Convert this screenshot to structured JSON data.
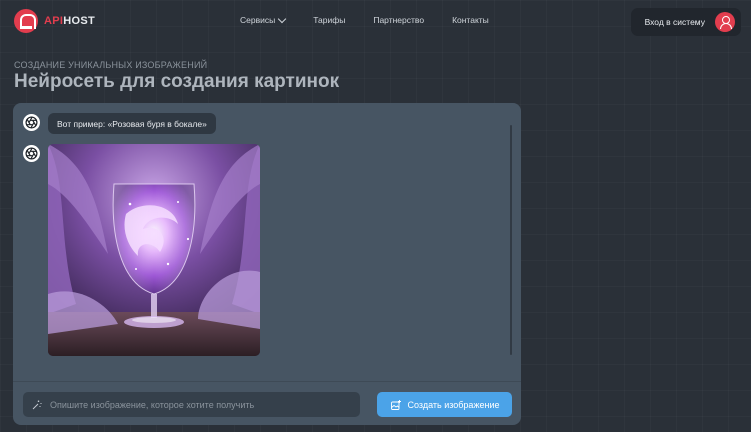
{
  "brand": {
    "api": "API",
    "host": "HOST",
    "accent": "#e23d4e"
  },
  "nav": {
    "items": [
      {
        "label": "Сервисы",
        "has_dropdown": true
      },
      {
        "label": "Тарифы"
      },
      {
        "label": "Партнерство"
      },
      {
        "label": "Контакты"
      }
    ]
  },
  "header": {
    "login_label": "Вход в систему",
    "avatar_icon": "user-icon"
  },
  "page": {
    "eyebrow": "СОЗДАНИЕ УНИКАЛЬНЫХ ИЗОБРАЖЕНИЙ",
    "title": "Нейросеть для создания картинок"
  },
  "chat": {
    "example_message": "Вот пример: «Розовая буря в бокале»",
    "bot_icon": "aperture-icon",
    "image_subject": "purple swirling storm inside a wine glass"
  },
  "composer": {
    "placeholder": "Опишите изображение, которое хотите получить",
    "value": "",
    "create_label": "Создать изображение",
    "button_color": "#4ba3e8"
  }
}
